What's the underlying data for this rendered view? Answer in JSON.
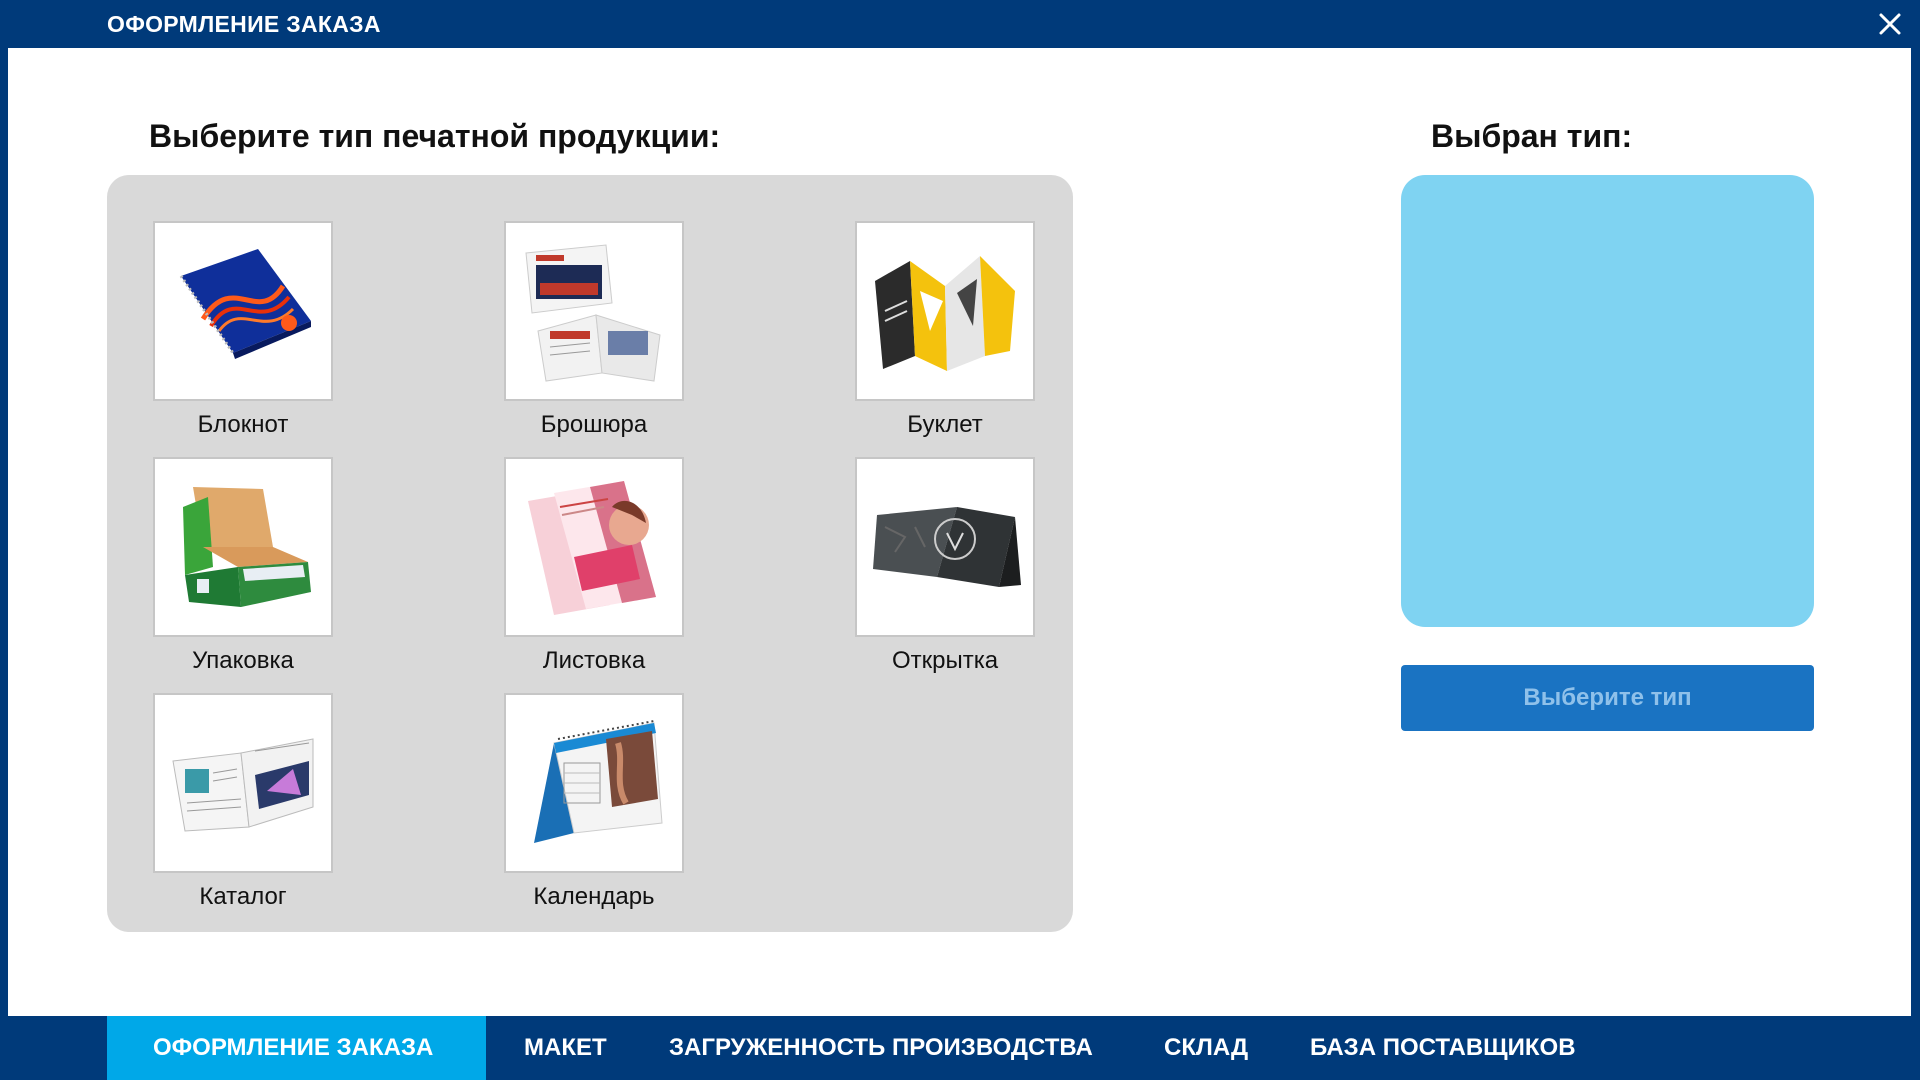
{
  "window": {
    "title": "ОФОРМЛЕНИЕ ЗАКАЗА",
    "close_icon": "close-icon"
  },
  "main": {
    "left_heading": "Выберите тип печатной продукции:",
    "right_heading": "Выбран тип:",
    "products": [
      {
        "label": "Блокнот",
        "icon": "notebook-icon"
      },
      {
        "label": "Брошюра",
        "icon": "brochure-icon"
      },
      {
        "label": "Буклет",
        "icon": "booklet-icon"
      },
      {
        "label": "Упаковка",
        "icon": "packaging-icon"
      },
      {
        "label": "Листовка",
        "icon": "flyer-icon"
      },
      {
        "label": "Открытка",
        "icon": "postcard-icon"
      },
      {
        "label": "Каталог",
        "icon": "catalog-icon"
      },
      {
        "label": "Календарь",
        "icon": "calendar-icon"
      }
    ],
    "select_button": "Выберите тип",
    "colors": {
      "preview_bg": "#7fd3f2",
      "button_bg": "#1a73c2",
      "brand": "#003a7a",
      "active_tab": "#00a8e8"
    }
  },
  "nav": {
    "tabs": [
      {
        "label": "ОФОРМЛЕНИЕ ЗАКАЗА",
        "active": true
      },
      {
        "label": "МАКЕТ",
        "active": false
      },
      {
        "label": "ЗАГРУЖЕННОСТЬ ПРОИЗВОДСТВА",
        "active": false
      },
      {
        "label": "СКЛАД",
        "active": false
      },
      {
        "label": "БАЗА ПОСТАВЩИКОВ",
        "active": false
      }
    ]
  }
}
